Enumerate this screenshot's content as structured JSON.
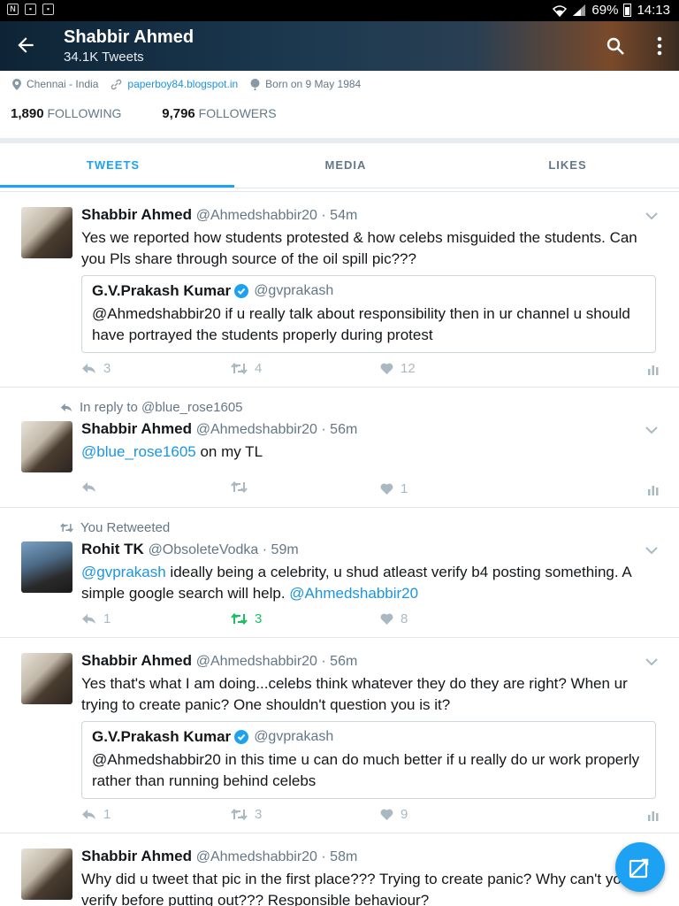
{
  "status_bar": {
    "battery": "69%",
    "time": "14:13"
  },
  "header": {
    "name": "Shabbir Ahmed",
    "tweet_count": "34.1K Tweets"
  },
  "profile": {
    "location": "Chennai - India",
    "website": "paperboy84.blogspot.in",
    "birthday": "Born on 9 May 1984",
    "following_count": "1,890",
    "following_label": "FOLLOWING",
    "followers_count": "9,796",
    "followers_label": "FOLLOWERS"
  },
  "tabs": [
    {
      "label": "TWEETS"
    },
    {
      "label": "MEDIA"
    },
    {
      "label": "LIKES"
    }
  ],
  "tweets": [
    {
      "name": "Shabbir Ahmed",
      "handle": "@Ahmedshabbir20 · 54m",
      "text": "Yes we reported how students protested & how celebs misguided the students. Can you Pls share through source of the oil spill pic???",
      "quote": {
        "name": "G.V.Prakash Kumar",
        "handle": "@gvprakash",
        "text": "@Ahmedshabbir20 if u really talk about responsibility then in ur channel u should have portrayed the students properly during protest"
      },
      "replies": "3",
      "retweets": "4",
      "likes": "12"
    },
    {
      "context": "In reply to @blue_rose1605",
      "name": "Shabbir Ahmed",
      "handle": "@Ahmedshabbir20 · 56m",
      "mention": "@blue_rose1605",
      "text_after": " on my TL",
      "replies": "",
      "retweets": "",
      "likes": "1"
    },
    {
      "context": "You Retweeted",
      "name": "Rohit TK",
      "handle": "@ObsoleteVodka · 59m",
      "mention": "@gvprakash",
      "text_mid": " ideally being a celebrity, u shud atleast verify b4 posting something. A simple google search will help. ",
      "mention2": "@Ahmedshabbir20",
      "replies": "1",
      "retweets": "3",
      "likes": "8"
    },
    {
      "name": "Shabbir Ahmed",
      "handle": "@Ahmedshabbir20 · 56m",
      "text": "Yes that's what I am doing...celebs think whatever they do they are right? When ur trying to create panic? One shouldn't question you is it?",
      "quote": {
        "name": "G.V.Prakash Kumar",
        "handle": "@gvprakash",
        "text": "@Ahmedshabbir20 in this time u can do much better if u really do ur work properly rather than running behind celebs"
      },
      "replies": "1",
      "retweets": "3",
      "likes": "9"
    },
    {
      "name": "Shabbir Ahmed",
      "handle": "@Ahmedshabbir20 · 58m",
      "text": "Why did u tweet that pic in the first place??? Trying to create panic? Why can't you verify before putting out??? Responsible behaviour?"
    }
  ],
  "colors": {
    "accent": "#1da1f2",
    "link": "#1b95e0",
    "retweeted": "#17bf63",
    "muted": "#657786"
  }
}
